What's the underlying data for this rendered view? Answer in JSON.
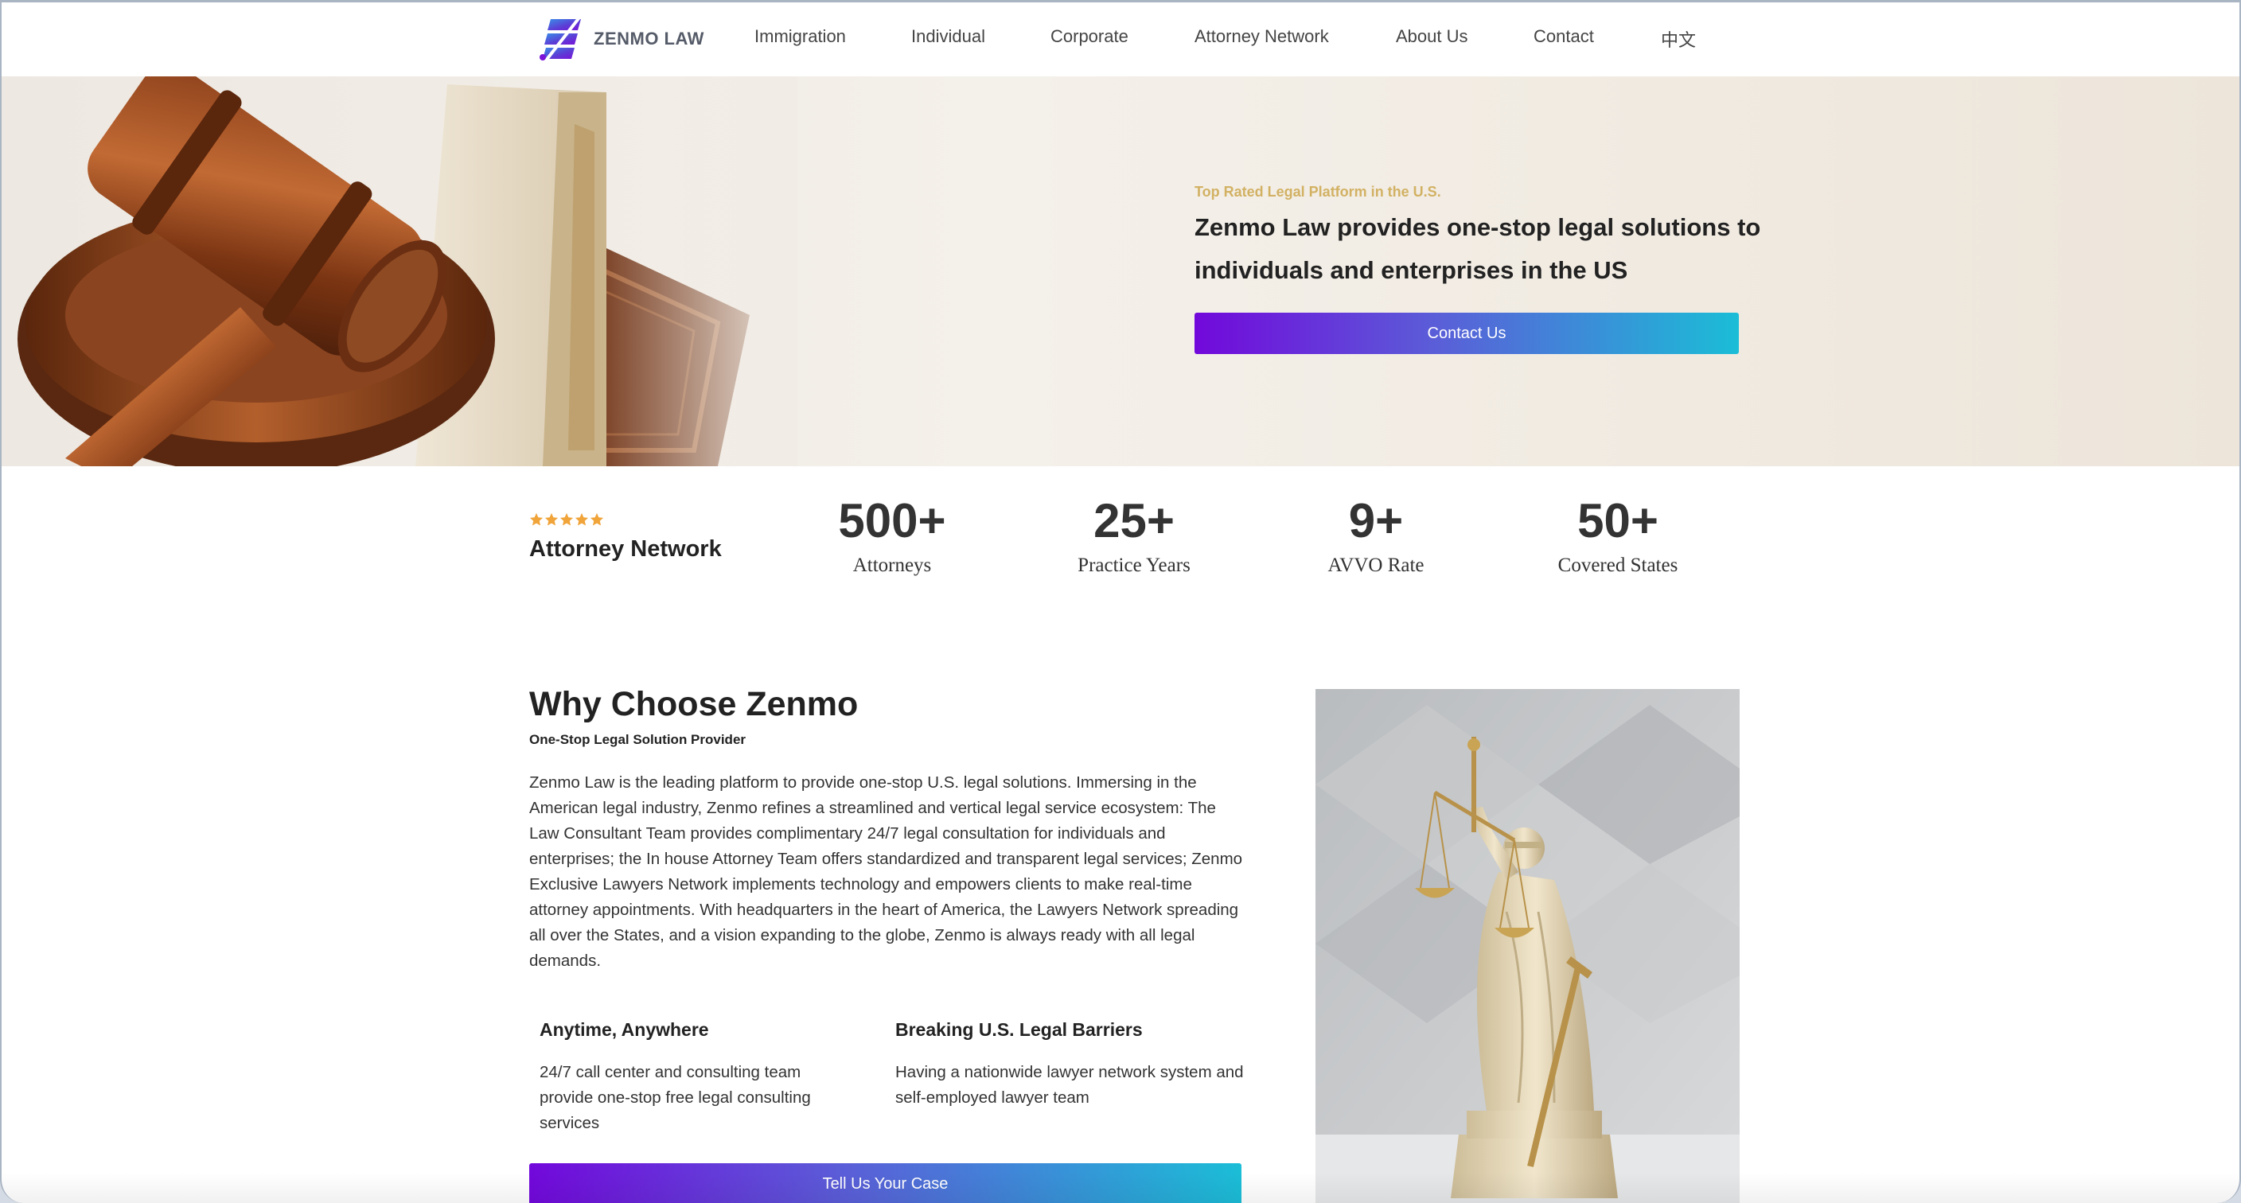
{
  "brand": {
    "name": "ZENMO LAW",
    "accent_purple": "#7208db",
    "accent_cyan": "#1bbdd7",
    "gold": "#d2b163"
  },
  "nav": {
    "items": [
      {
        "label": "Immigration"
      },
      {
        "label": "Individual"
      },
      {
        "label": "Corporate"
      },
      {
        "label": "Attorney Network"
      },
      {
        "label": "About Us"
      },
      {
        "label": "Contact"
      },
      {
        "label": "中文"
      }
    ]
  },
  "hero": {
    "tagline": "Top Rated Legal Platform in the U.S.",
    "title": "Zenmo Law provides one-stop legal solutions to individuals and enterprises in the US",
    "cta_label": "Contact Us",
    "image_icon": "gavel-and-book-image"
  },
  "stats": {
    "rating_stars": 5,
    "label": "Attorney Network",
    "items": [
      {
        "value": "500+",
        "caption": "Attorneys"
      },
      {
        "value": "25+",
        "caption": "Practice Years"
      },
      {
        "value": "9+",
        "caption": "AVVO Rate"
      },
      {
        "value": "50+",
        "caption": "Covered States"
      }
    ]
  },
  "why": {
    "title": "Why Choose Zenmo",
    "subtitle": "One-Stop Legal Solution Provider",
    "body": "Zenmo Law is the leading platform to provide one-stop U.S. legal solutions. Immersing in the American legal industry, Zenmo refines a streamlined and vertical legal service ecosystem: The Law Consultant Team provides  complimentary 24/7 legal consultation for individuals and enterprises; the In  house Attorney Team offers  standardized and  transparent legal services; Zenmo Exclusive Lawyers Network implements technology and empowers clients to make real-time attorney appointments. With headquarters in the heart of America, the Lawyers Network spreading all over the States, and a vision expanding to the globe, Zenmo is always ready with all legal demands.",
    "features": [
      {
        "title": "Anytime, Anywhere",
        "text": "24/7 call center and consulting team provide one-stop free legal consulting services"
      },
      {
        "title": "Breaking U.S. Legal Barriers",
        "text": "Having a nationwide lawyer network system and self-employed lawyer team"
      }
    ],
    "cta_label": "Tell Us Your Case",
    "image_icon": "lady-justice-statue-image"
  }
}
